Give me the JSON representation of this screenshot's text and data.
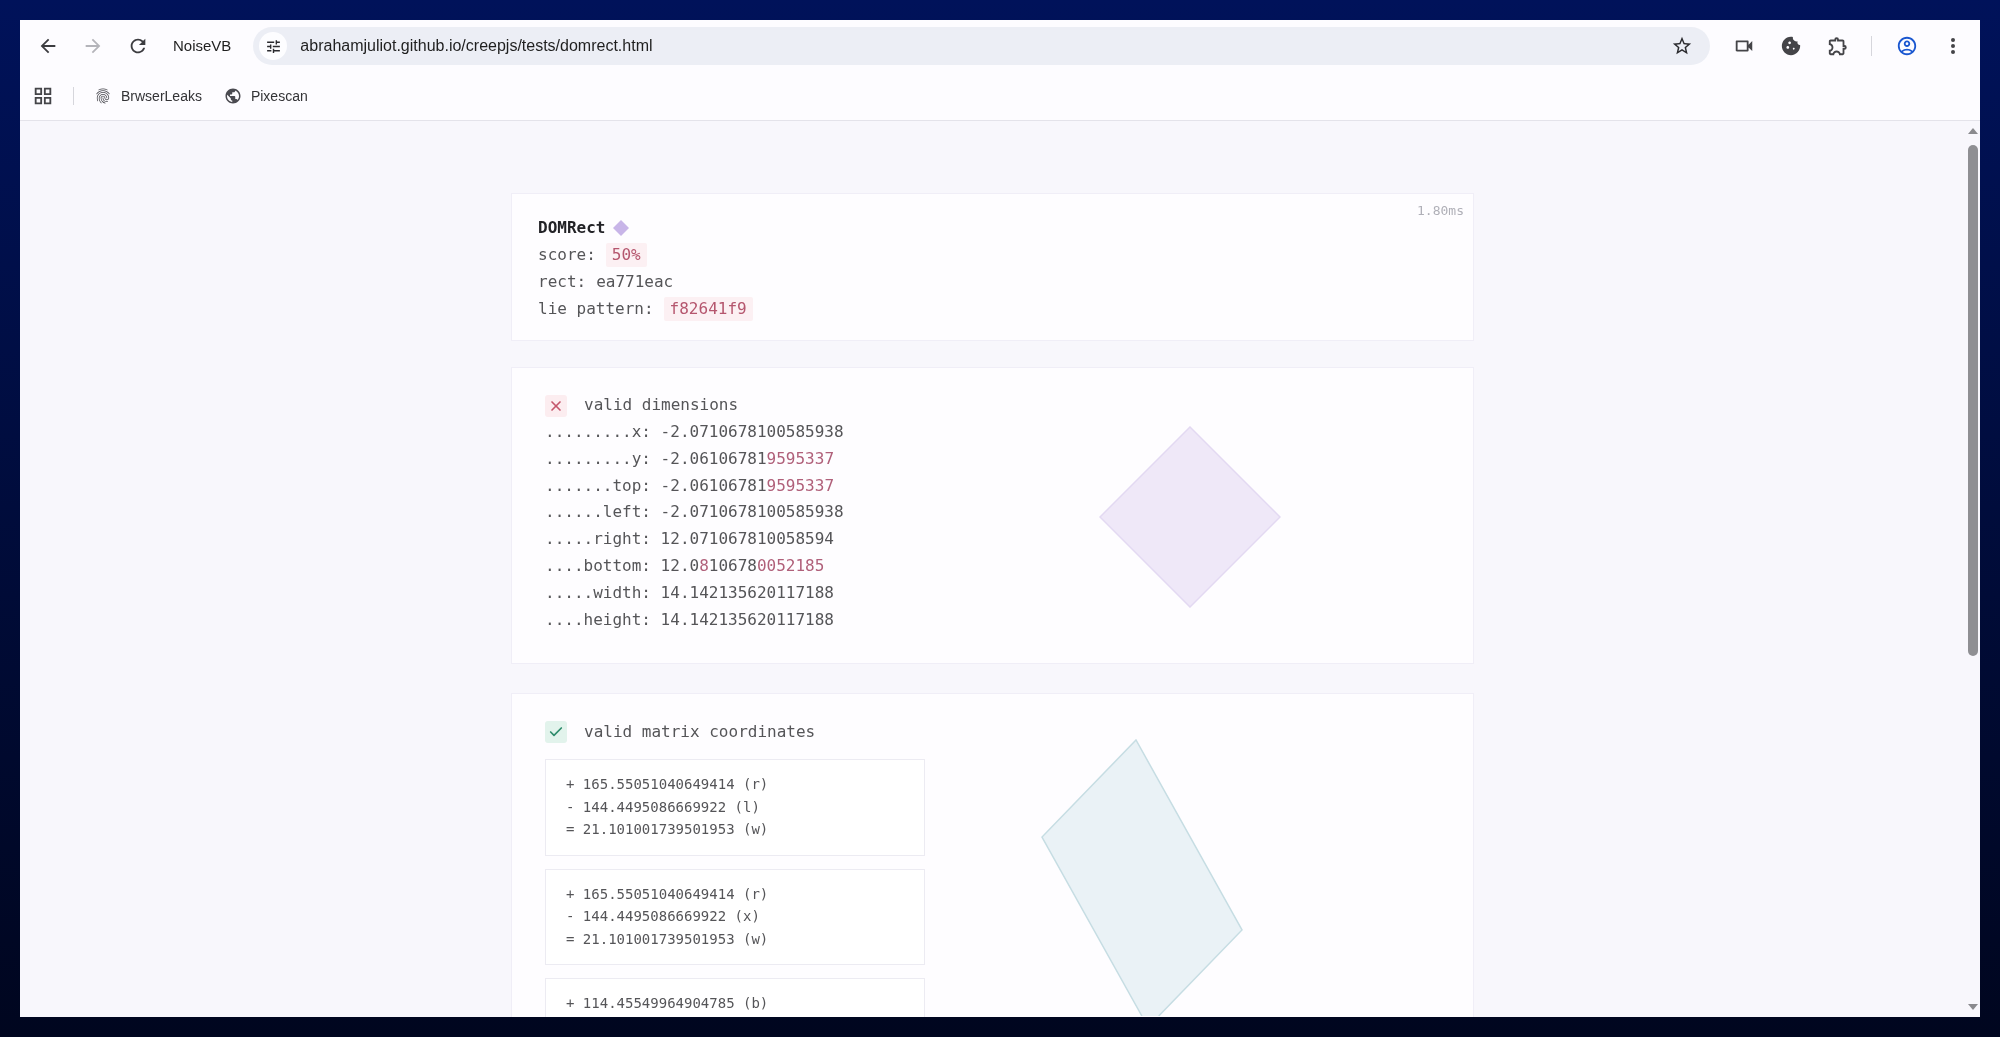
{
  "navigation": [
    {
      "kind": "back",
      "disabled": false
    },
    {
      "kind": "forward",
      "disabled": true
    },
    {
      "kind": "reload",
      "disabled": false
    }
  ],
  "toolbar_label": "NoiseVB",
  "address_bar": {
    "url": "abrahamjuliot.github.io/creepjs/tests/domrect.html"
  },
  "bookmarks": [
    {
      "kind": "fingerprint",
      "label": "BrwserLeaks"
    },
    {
      "kind": "globe",
      "label": "Pixescan"
    }
  ],
  "summary_card": {
    "title": "DOMRect",
    "timing": "1.80ms",
    "rows": [
      {
        "label": "score:",
        "value": "50%",
        "flagged": true
      },
      {
        "label": "rect:",
        "value": "ea771eac",
        "flagged": false
      },
      {
        "label": "lie pattern:",
        "value": "f82641f9",
        "flagged": true
      }
    ]
  },
  "dimensions_card": {
    "title": "valid dimensions",
    "passed": false,
    "rows": [
      {
        "label": ".........x:",
        "segments": [
          {
            "text": "-2.0710678100585938",
            "mismatch": false
          }
        ]
      },
      {
        "label": ".........y:",
        "segments": [
          {
            "text": "-2.06106781",
            "mismatch": false
          },
          {
            "text": "9595337",
            "mismatch": true
          }
        ]
      },
      {
        "label": ".......top:",
        "segments": [
          {
            "text": "-2.06106781",
            "mismatch": false
          },
          {
            "text": "9595337",
            "mismatch": true
          }
        ]
      },
      {
        "label": "......left:",
        "segments": [
          {
            "text": "-2.0710678100585938",
            "mismatch": false
          }
        ]
      },
      {
        "label": ".....right:",
        "segments": [
          {
            "text": "12.071067810058594",
            "mismatch": false
          }
        ]
      },
      {
        "label": "....bottom:",
        "segments": [
          {
            "text": "12.0",
            "mismatch": false
          },
          {
            "text": "8",
            "mismatch": true
          },
          {
            "text": "10678",
            "mismatch": false
          },
          {
            "text": "0052185",
            "mismatch": true
          }
        ]
      },
      {
        "label": ".....width:",
        "segments": [
          {
            "text": "14.142135620117188",
            "mismatch": false
          }
        ]
      },
      {
        "label": "....height:",
        "segments": [
          {
            "text": "14.142135620117188",
            "mismatch": false
          }
        ]
      }
    ]
  },
  "matrix_card": {
    "title": "valid matrix coordinates",
    "passed": true,
    "groups": [
      {
        "lines": [
          "+ 165.55051040649414 (r)",
          "- 144.4495086669922 (l)",
          "= 21.101001739501953 (w)"
        ]
      },
      {
        "lines": [
          "+ 165.55051040649414 (r)",
          "- 144.4495086669922 (x)",
          "= 21.101001739501953 (w)"
        ]
      },
      {
        "lines": [
          "+ 114.45549964904785 (b)"
        ]
      }
    ]
  }
}
